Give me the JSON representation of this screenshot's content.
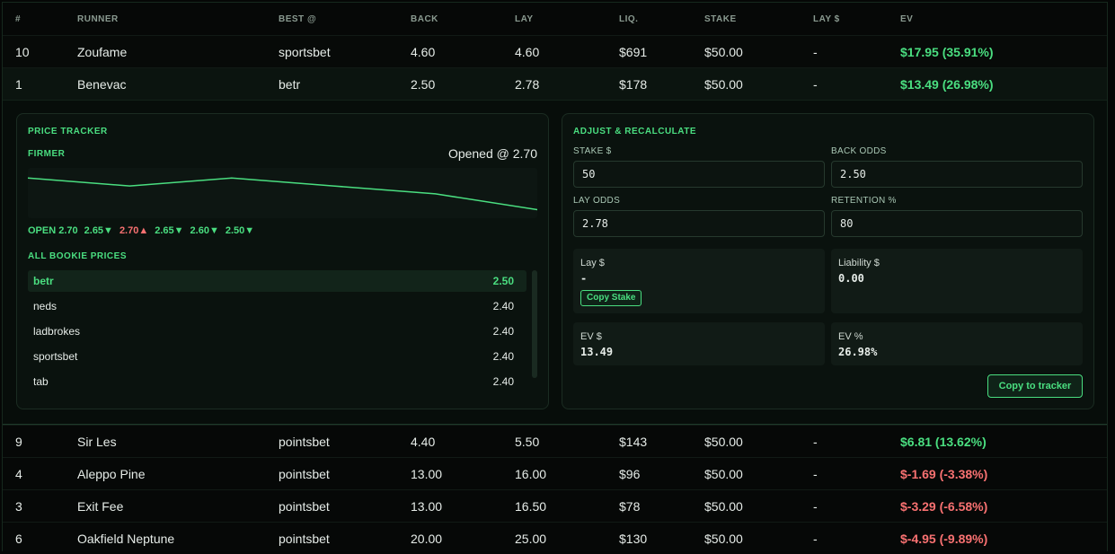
{
  "table": {
    "headers": [
      "#",
      "RUNNER",
      "BEST @",
      "BACK",
      "LAY",
      "LIQ.",
      "STAKE",
      "LAY $",
      "EV"
    ],
    "rows_top": [
      {
        "num": "10",
        "runner": "Zoufame",
        "best": "sportsbet",
        "back": "4.60",
        "lay": "4.60",
        "liq": "$691",
        "stake": "$50.00",
        "lay_amt": "-",
        "ev": "$17.95 (35.91%)",
        "ev_sign": "pos"
      },
      {
        "num": "1",
        "runner": "Benevac",
        "best": "betr",
        "back": "2.50",
        "lay": "2.78",
        "liq": "$178",
        "stake": "$50.00",
        "lay_amt": "-",
        "ev": "$13.49 (26.98%)",
        "ev_sign": "pos"
      }
    ],
    "rows_bottom": [
      {
        "num": "9",
        "runner": "Sir Les",
        "best": "pointsbet",
        "back": "4.40",
        "lay": "5.50",
        "liq": "$143",
        "stake": "$50.00",
        "lay_amt": "-",
        "ev": "$6.81 (13.62%)",
        "ev_sign": "pos"
      },
      {
        "num": "4",
        "runner": "Aleppo Pine",
        "best": "pointsbet",
        "back": "13.00",
        "lay": "16.00",
        "liq": "$96",
        "stake": "$50.00",
        "lay_amt": "-",
        "ev": "$-1.69 (-3.38%)",
        "ev_sign": "neg"
      },
      {
        "num": "3",
        "runner": "Exit Fee",
        "best": "pointsbet",
        "back": "13.00",
        "lay": "16.50",
        "liq": "$78",
        "stake": "$50.00",
        "lay_amt": "-",
        "ev": "$-3.29 (-6.58%)",
        "ev_sign": "neg"
      },
      {
        "num": "6",
        "runner": "Oakfield Neptune",
        "best": "pointsbet",
        "back": "20.00",
        "lay": "25.00",
        "liq": "$130",
        "stake": "$50.00",
        "lay_amt": "-",
        "ev": "$-4.95 (-9.89%)",
        "ev_sign": "neg"
      }
    ]
  },
  "tracker": {
    "title": "PRICE TRACKER",
    "trend": "FIRMER",
    "opened": "Opened @ 2.70",
    "price_history": [
      2.7,
      2.65,
      2.7,
      2.65,
      2.6,
      2.5
    ],
    "moves": [
      {
        "label": "OPEN 2.70",
        "dir": "none"
      },
      {
        "label": "2.65▼",
        "dir": "down"
      },
      {
        "label": "2.70▲",
        "dir": "up"
      },
      {
        "label": "2.65▼",
        "dir": "down"
      },
      {
        "label": "2.60▼",
        "dir": "down"
      },
      {
        "label": "2.50▼",
        "dir": "down"
      }
    ],
    "bookies_title": "ALL BOOKIE PRICES",
    "bookies": [
      {
        "name": "betr",
        "price": "2.50",
        "best": true
      },
      {
        "name": "neds",
        "price": "2.40",
        "best": false
      },
      {
        "name": "ladbrokes",
        "price": "2.40",
        "best": false
      },
      {
        "name": "sportsbet",
        "price": "2.40",
        "best": false
      },
      {
        "name": "tab",
        "price": "2.40",
        "best": false
      }
    ]
  },
  "calc": {
    "title": "ADJUST & RECALCULATE",
    "stake_label": "STAKE $",
    "stake_value": "50",
    "back_label": "BACK ODDS",
    "back_value": "2.50",
    "lay_label": "LAY ODDS",
    "lay_value": "2.78",
    "retention_label": "RETENTION %",
    "retention_value": "80",
    "lay_amt_label": "Lay $",
    "lay_amt_value": "-",
    "copy_stake": "Copy Stake",
    "liability_label": "Liability $",
    "liability_value": "0.00",
    "ev_amt_label": "EV $",
    "ev_amt_value": "13.49",
    "ev_pct_label": "EV %",
    "ev_pct_value": "26.98%",
    "copy_tracker": "Copy to tracker"
  },
  "colors": {
    "accent": "#4ade80",
    "negative": "#f87171",
    "background": "#050706"
  }
}
